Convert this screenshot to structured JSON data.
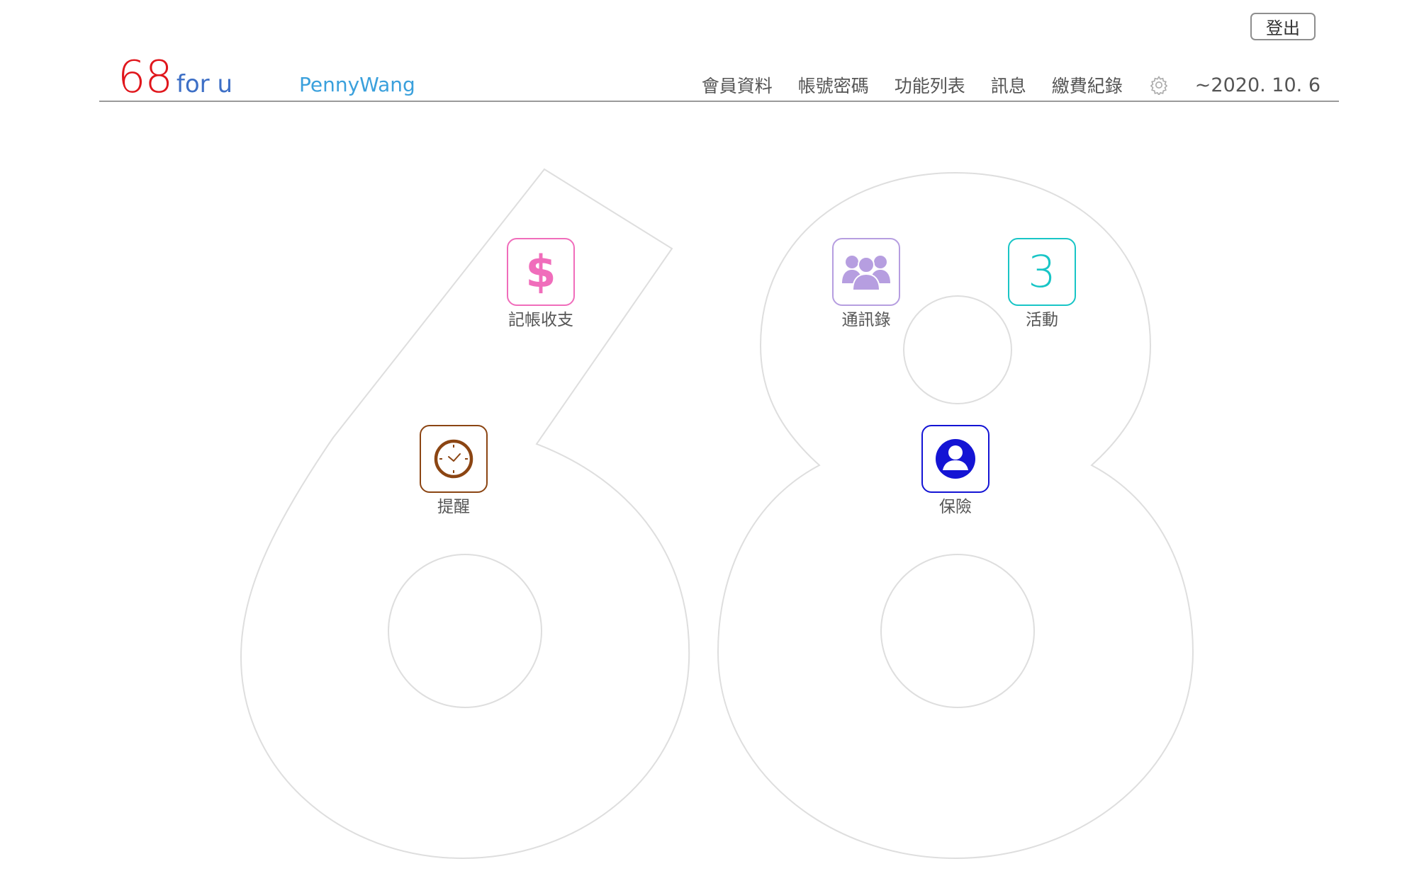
{
  "header": {
    "logout_label": "登出",
    "logo_number": "68",
    "logo_suffix": "for u",
    "username": "PennyWang",
    "nav": [
      {
        "label": "會員資料"
      },
      {
        "label": "帳號密碼"
      },
      {
        "label": "功能列表"
      },
      {
        "label": "訊息"
      },
      {
        "label": "繳費紀錄"
      }
    ],
    "settings_icon": "gear-icon",
    "date": "~2020. 10. 6"
  },
  "tiles": [
    {
      "label": "記帳收支",
      "icon": "dollar-icon",
      "color": "#f06dbb"
    },
    {
      "label": "通訊錄",
      "icon": "contacts-group-icon",
      "color": "#b69ee0"
    },
    {
      "label": "活動",
      "icon": "activity-count",
      "count": "3",
      "color": "#18c5c6"
    },
    {
      "label": "提醒",
      "icon": "clock-icon",
      "color": "#8b4513"
    },
    {
      "label": "保險",
      "icon": "person-icon",
      "color": "#1414d4"
    }
  ],
  "colors": {
    "logo_red": "#e0161c",
    "logo_blue": "#3d6fc6",
    "username_blue": "#3aa0dc",
    "outline_gray": "#dedede"
  }
}
